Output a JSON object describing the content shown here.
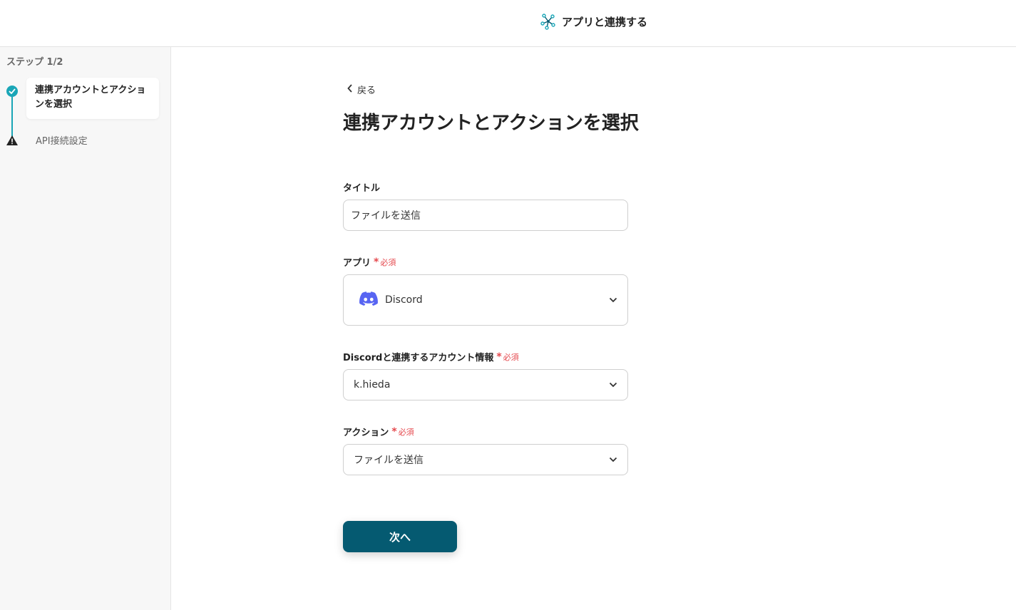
{
  "header": {
    "title": "アプリと連携する",
    "icon": "nodes-icon"
  },
  "sidebar": {
    "step_count": "ステップ 1/2",
    "steps": [
      {
        "label": "連携アカウントとアクションを選択",
        "status": "done",
        "icon": "check-circle-icon"
      },
      {
        "label": "API接続設定",
        "status": "warning",
        "icon": "warning-triangle-icon"
      }
    ]
  },
  "main": {
    "back_label": "戻る",
    "page_title": "連携アカウントとアクションを選択",
    "title_field": {
      "label": "タイトル",
      "value": "ファイルを送信"
    },
    "app_field": {
      "label": "アプリ",
      "required": "必須",
      "value": "Discord",
      "icon": "discord-icon"
    },
    "account_field": {
      "label": "Discordと連携するアカウント情報",
      "required": "必須",
      "value": "k.hieda"
    },
    "action_field": {
      "label": "アクション",
      "required": "必須",
      "value": "ファイルを送信"
    },
    "next_label": "次へ"
  },
  "colors": {
    "accent": "#1aa6b7",
    "primary_button": "#055a71",
    "required": "#e5484d",
    "discord": "#5865f2"
  }
}
